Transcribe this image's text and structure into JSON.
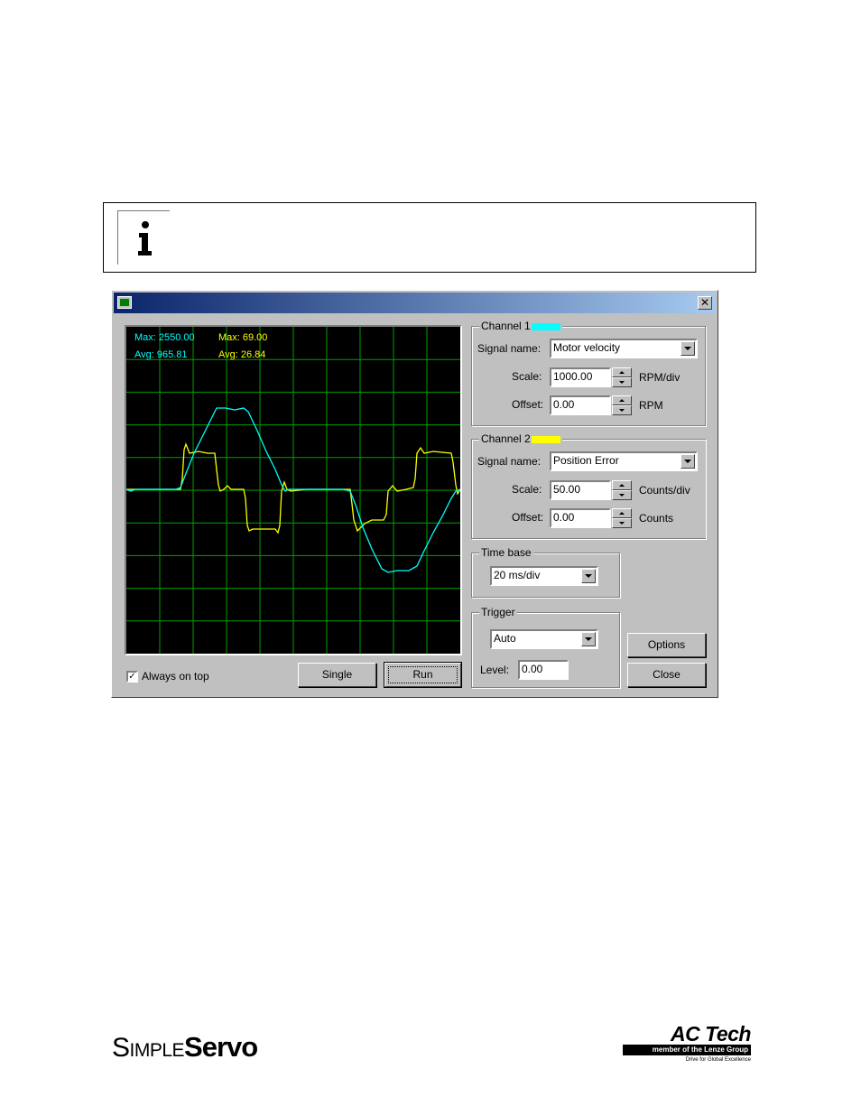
{
  "note": {
    "icon": "info-icon"
  },
  "window": {
    "title": "",
    "close_glyph": "✕"
  },
  "scope": {
    "ch1_max": "Max: 2550.00",
    "ch1_avg": "Avg: 965.81",
    "ch2_max": "Max: 69.00",
    "ch2_avg": "Avg: 26.84",
    "ch1_color": "#00ffff",
    "ch2_color": "#ffff00",
    "grid_color": "#00a000",
    "grid_divisions": {
      "x": 10,
      "y": 10
    }
  },
  "always_on_top": {
    "label": "Always on top",
    "checked": true,
    "check_glyph": "✓"
  },
  "buttons": {
    "single": "Single",
    "run": "Run",
    "options": "Options",
    "close": "Close"
  },
  "channel1": {
    "label": "Channel 1",
    "color": "#00ffff",
    "signal_label": "Signal name:",
    "signal_value": "Motor velocity",
    "scale_label": "Scale:",
    "scale_value": "1000.00",
    "scale_unit": "RPM/div",
    "offset_label": "Offset:",
    "offset_value": "0.00",
    "offset_unit": "RPM"
  },
  "channel2": {
    "label": "Channel 2",
    "color": "#ffff00",
    "signal_label": "Signal name:",
    "signal_value": "Position Error",
    "scale_label": "Scale:",
    "scale_value": "50.00",
    "scale_unit": "Counts/div",
    "offset_label": "Offset:",
    "offset_value": "0.00",
    "offset_unit": "Counts"
  },
  "time_base": {
    "label": "Time base",
    "value": "20 ms/div"
  },
  "trigger": {
    "label": "Trigger",
    "mode": "Auto",
    "level_label": "Level:",
    "level_value": "0.00"
  },
  "footer": {
    "brand_left_a": "Simple",
    "brand_left_b": "Servo",
    "brand_right": "AC Tech",
    "brand_right_bar": "member of the Lenze Group",
    "brand_right_tag": "Drive for Global Excellence"
  }
}
